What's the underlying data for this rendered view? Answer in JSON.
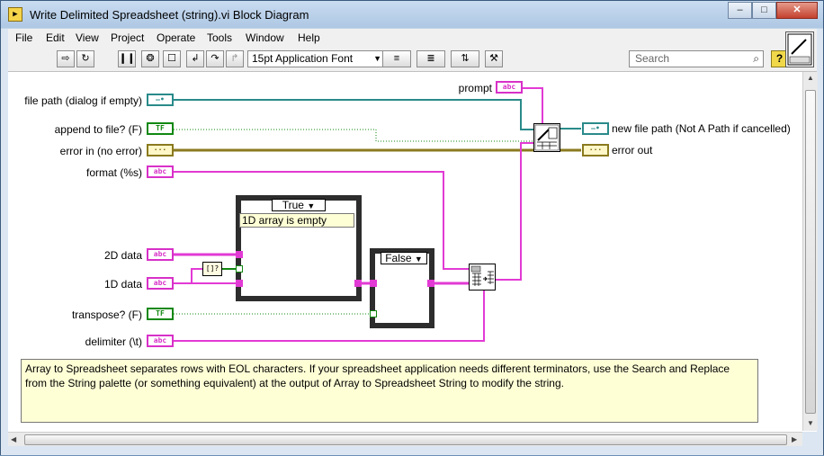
{
  "window": {
    "title": "Write Delimited Spreadsheet (string).vi Block Diagram",
    "icon": "labview-vi-icon",
    "controls": {
      "minimize": "–",
      "maximize": "□",
      "close": "✕"
    }
  },
  "menu": [
    "File",
    "Edit",
    "View",
    "Project",
    "Operate",
    "Tools",
    "Window",
    "Help"
  ],
  "toolbar": {
    "run": "⇨",
    "run_continuously": "↻",
    "pause": "❙❙",
    "highlight_execution": "❂",
    "retain_wire_values": "☐",
    "step_into": "↲",
    "step_over": "↷",
    "step_out": "↱",
    "font": "15pt Application Font",
    "align": "≡",
    "distribute": "≣",
    "reorder": "⇅",
    "cleanup": "⚒",
    "search_placeholder": "Search",
    "help": "?"
  },
  "terminals": {
    "file_path": {
      "label": "file path (dialog if empty)",
      "glyph": "—•"
    },
    "append": {
      "label": "append to file? (F)",
      "glyph": "TF"
    },
    "error_in": {
      "label": "error in (no error)",
      "glyph": "···"
    },
    "format": {
      "label": "format (%s)",
      "glyph": "abc"
    },
    "data2d": {
      "label": "2D data",
      "glyph": "abc"
    },
    "data1d": {
      "label": "1D data",
      "glyph": "abc"
    },
    "transpose": {
      "label": "transpose? (F)",
      "glyph": "TF"
    },
    "delimiter": {
      "label": "delimiter (\\t)",
      "glyph": "abc"
    },
    "prompt": {
      "label": "prompt",
      "glyph": "abc"
    },
    "new_path": {
      "label": "new file path (Not A Path if cancelled)",
      "glyph": "—•"
    },
    "error_out": {
      "label": "error out",
      "glyph": "···"
    }
  },
  "case_outer": {
    "selector": "True",
    "note": "1D array is empty"
  },
  "case_inner": {
    "selector": "False"
  },
  "comparator": {
    "glyph": "[]?"
  },
  "comment": "Array to Spreadsheet separates rows with EOL characters.  If your spreadsheet application needs different terminators, use the Search and Replace from the String palette (or something equivalent) at the output of Array to Spreadsheet String to modify the string.",
  "colors": {
    "string_wire": "#e23ad4",
    "path_wire": "#2a8a8a",
    "bool_wire": "#118811",
    "error_wire": "#8a7a1e"
  }
}
